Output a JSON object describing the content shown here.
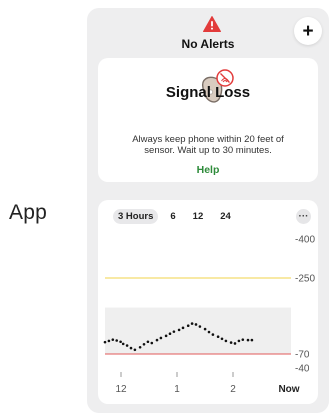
{
  "side_label": "App",
  "header": {
    "alert_title": "No Alerts",
    "add_label": "+"
  },
  "signal_card": {
    "title": "Signal Loss",
    "message": "Always keep phone within 20 feet of sensor. Wait up to 30 minutes.",
    "help_label": "Help"
  },
  "chart_tabs": [
    {
      "label": "3 Hours",
      "active": true
    },
    {
      "label": "6",
      "active": false
    },
    {
      "label": "12",
      "active": false
    },
    {
      "label": "24",
      "active": false
    }
  ],
  "more_label": "···",
  "colors": {
    "alert_red": "#e23b3b",
    "high_line": "#f2d34a",
    "low_line": "#e05a5a",
    "target_band": "#efefef",
    "help_green": "#2e8b3a"
  },
  "chart_data": {
    "type": "scatter",
    "title": "",
    "xlabel": "",
    "ylabel": "",
    "y_ticks": [
      "400",
      "250",
      "70",
      "40"
    ],
    "y_tick_values": [
      400,
      250,
      70,
      40
    ],
    "x_ticks": [
      "12",
      "1",
      "2",
      "Now"
    ],
    "high_threshold": 250,
    "low_threshold": 70,
    "target_range": [
      70,
      180
    ],
    "series": [
      {
        "values": [
          [
            0.0,
            98
          ],
          [
            0.03,
            101
          ],
          [
            0.06,
            104
          ],
          [
            0.09,
            102
          ],
          [
            0.12,
            99
          ],
          [
            0.14,
            94
          ],
          [
            0.17,
            90
          ],
          [
            0.2,
            84
          ],
          [
            0.23,
            80
          ],
          [
            0.27,
            86
          ],
          [
            0.3,
            93
          ],
          [
            0.33,
            99
          ],
          [
            0.36,
            96
          ],
          [
            0.4,
            103
          ],
          [
            0.43,
            108
          ],
          [
            0.47,
            113
          ],
          [
            0.5,
            118
          ],
          [
            0.53,
            123
          ],
          [
            0.57,
            127
          ],
          [
            0.6,
            132
          ],
          [
            0.64,
            137
          ],
          [
            0.67,
            142
          ],
          [
            0.7,
            140
          ],
          [
            0.73,
            135
          ],
          [
            0.77,
            129
          ],
          [
            0.8,
            122
          ],
          [
            0.83,
            116
          ],
          [
            0.87,
            111
          ],
          [
            0.9,
            106
          ],
          [
            0.93,
            101
          ],
          [
            0.97,
            97
          ],
          [
            1.0,
            95
          ],
          [
            1.03,
            101
          ],
          [
            1.06,
            104
          ],
          [
            1.1,
            103
          ],
          [
            1.13,
            103
          ]
        ]
      }
    ]
  }
}
